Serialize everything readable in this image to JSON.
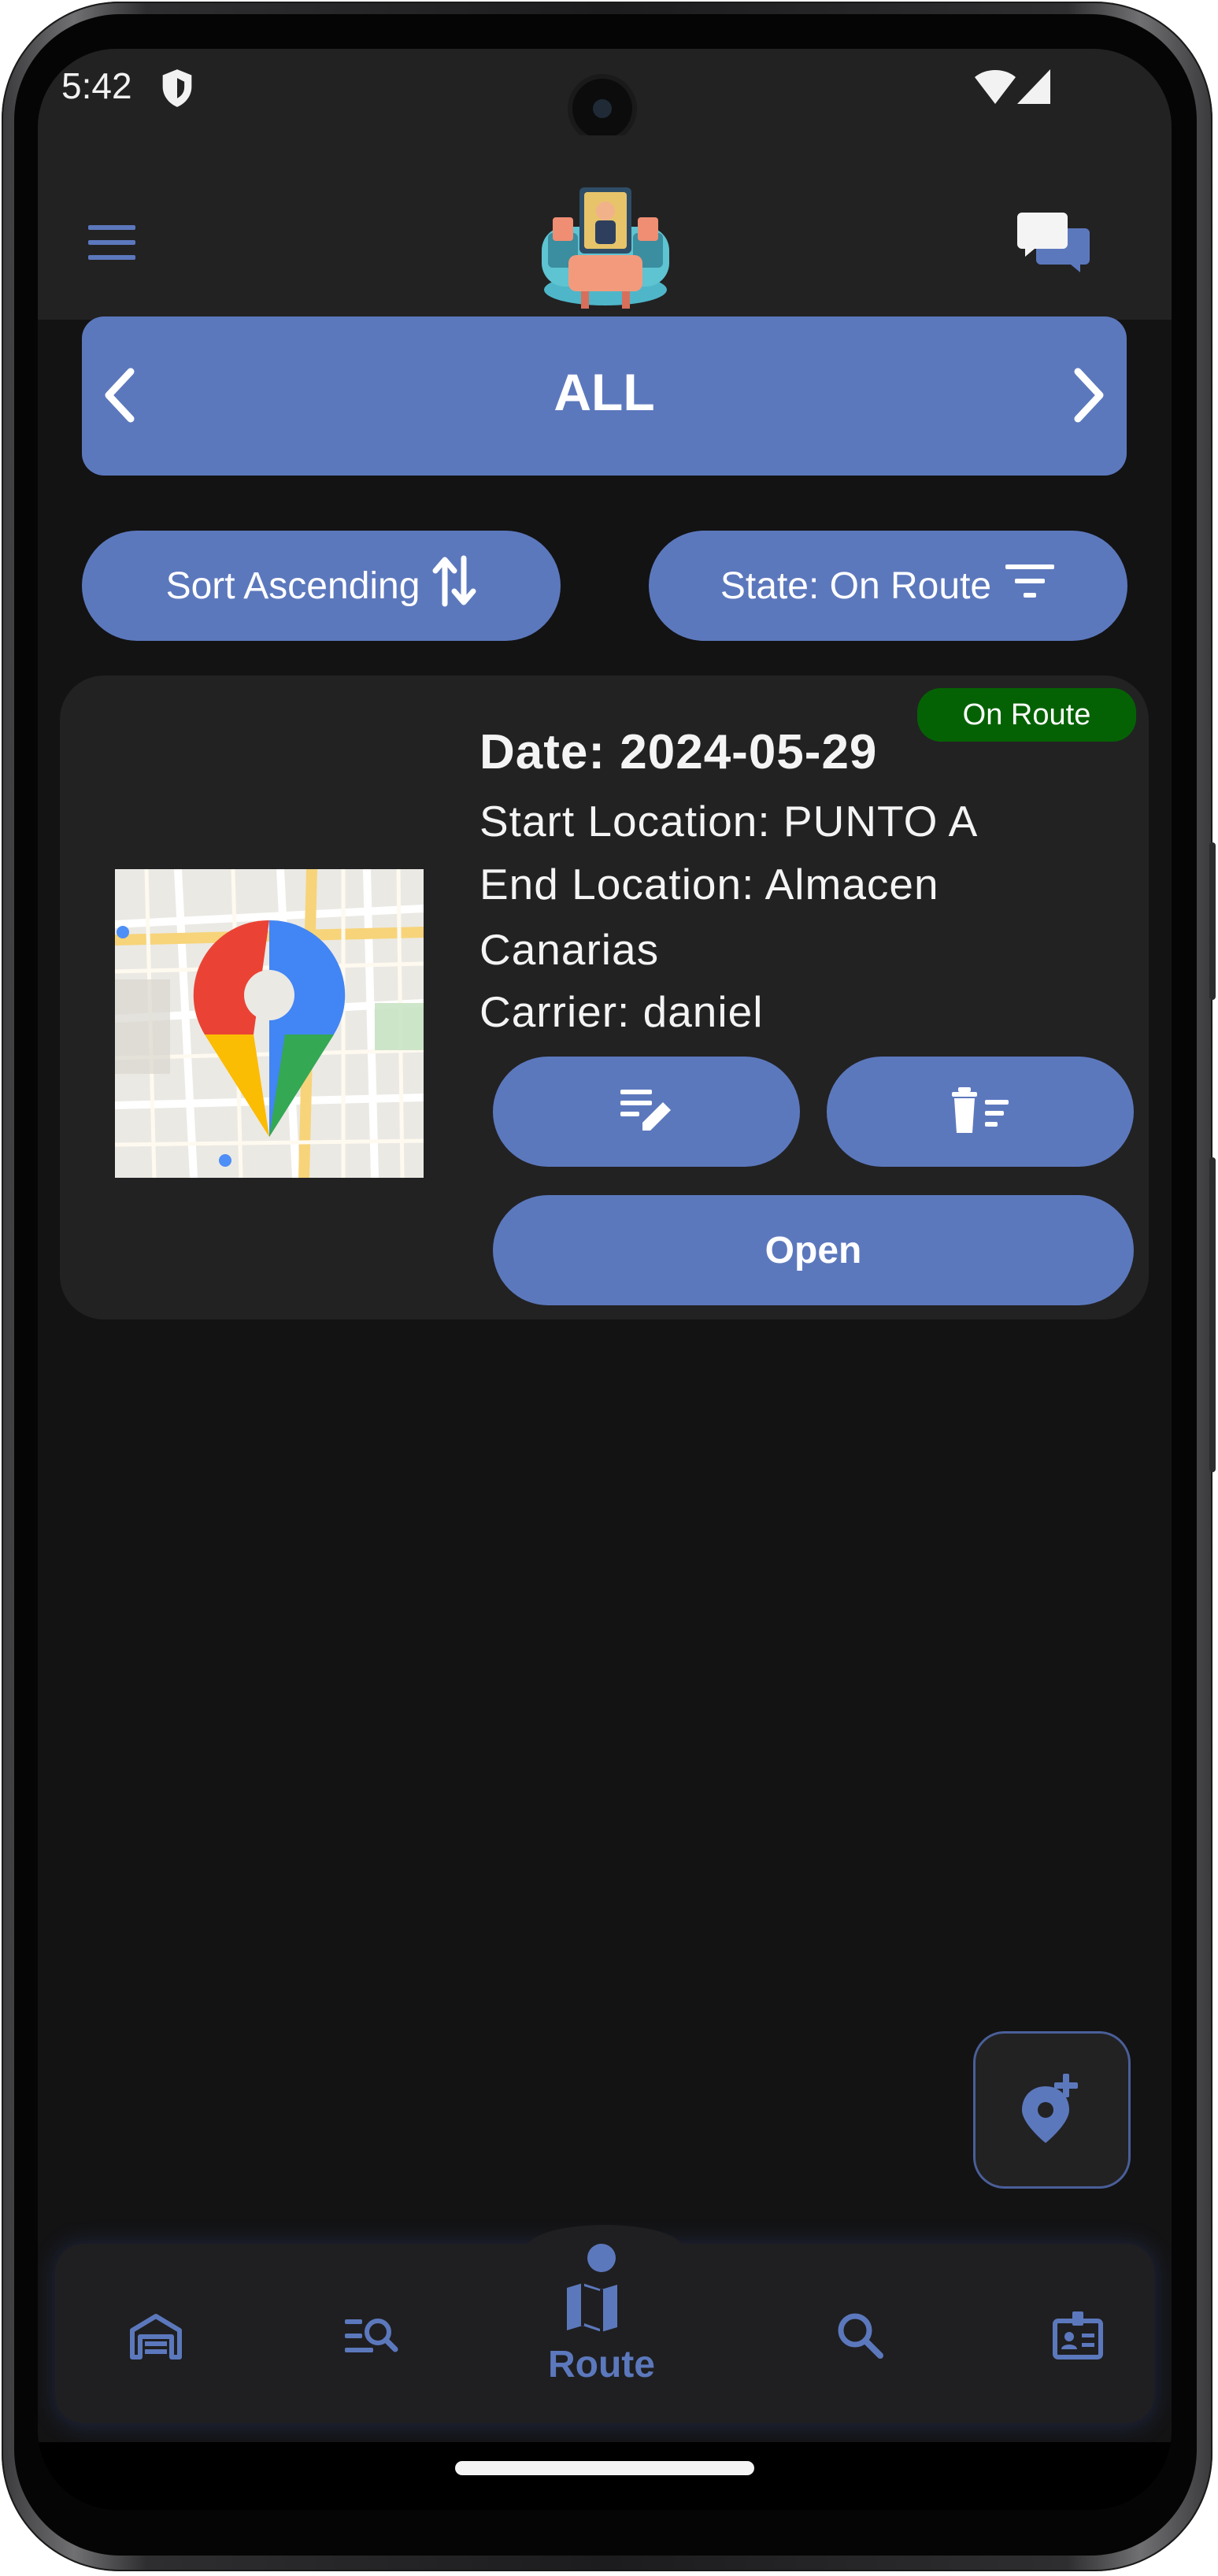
{
  "colors": {
    "accent": "#5c78bd",
    "background": "#131314",
    "surface": "#222223",
    "badge_green": "#056204",
    "text": "#ffffff"
  },
  "status_bar": {
    "time": "5:42",
    "icons": [
      "shield-icon",
      "wifi-icon",
      "signal-icon"
    ]
  },
  "app_bar": {
    "menu_icon": "menu-icon",
    "logo_icon": "app-logo",
    "chat_icon": "chat-icon"
  },
  "pager": {
    "title": "ALL",
    "prev_icon": "chevron-left-icon",
    "next_icon": "chevron-right-icon"
  },
  "filters": {
    "sort_label": "Sort Ascending",
    "sort_icon": "swap-vertical-icon",
    "state_label": "State: On Route",
    "state_icon": "filter-icon"
  },
  "route_card": {
    "badge": "On Route",
    "date": "Date: 2024-05-29",
    "start_location": "Start Location: PUNTO A",
    "end_location_line1": "End Location: Almacen",
    "end_location_line2": "Canarias",
    "carrier": "Carrier: daniel",
    "edit_icon": "edit-note-icon",
    "delete_icon": "delete-sweep-icon",
    "open_label": "Open"
  },
  "fab": {
    "icon": "add-location-icon"
  },
  "bottom_nav": {
    "items": [
      {
        "icon": "warehouse-icon",
        "label": ""
      },
      {
        "icon": "manage-search-icon",
        "label": ""
      },
      {
        "icon": "map-icon",
        "label": "Route",
        "active": true
      },
      {
        "icon": "search-icon",
        "label": ""
      },
      {
        "icon": "badge-icon",
        "label": ""
      }
    ]
  }
}
